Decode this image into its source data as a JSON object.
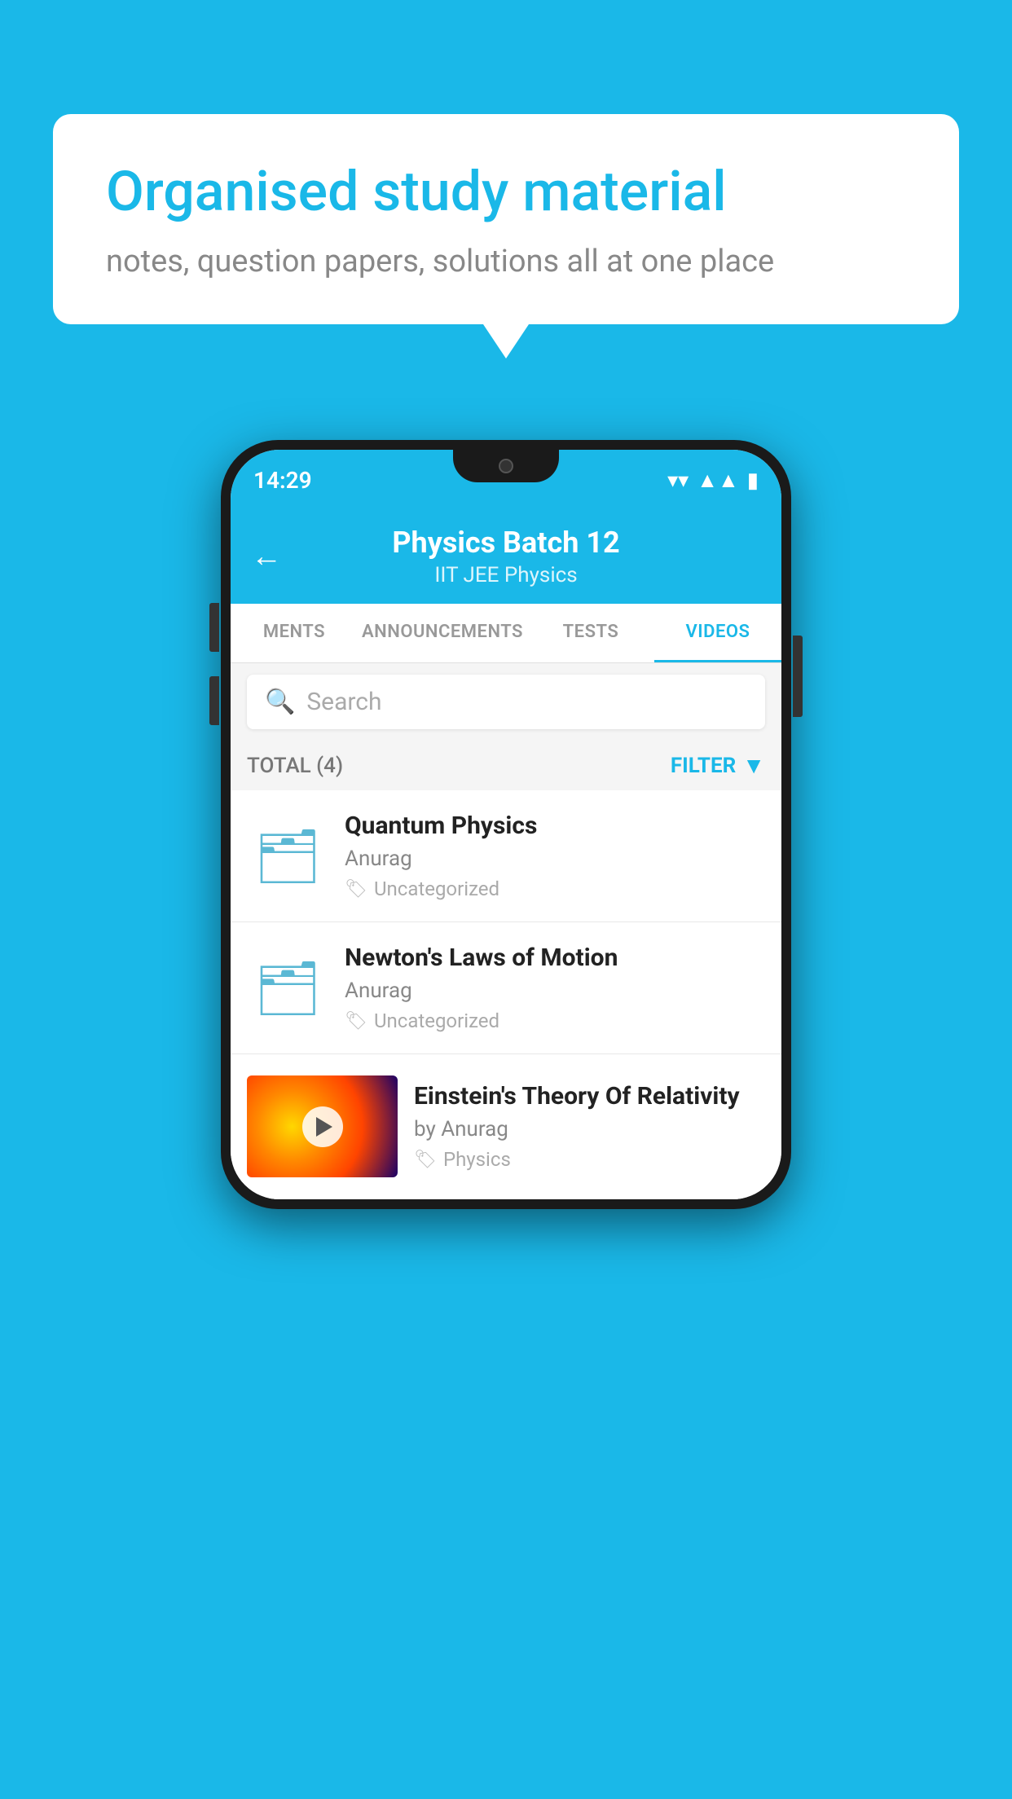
{
  "background_color": "#1ab8e8",
  "speech_bubble": {
    "title": "Organised study material",
    "subtitle": "notes, question papers, solutions all at one place"
  },
  "phone": {
    "status_bar": {
      "time": "14:29"
    },
    "app_bar": {
      "title": "Physics Batch 12",
      "subtitle": "IIT JEE   Physics",
      "back_label": "←"
    },
    "tabs": [
      {
        "label": "MENTS",
        "active": false
      },
      {
        "label": "ANNOUNCEMENTS",
        "active": false
      },
      {
        "label": "TESTS",
        "active": false
      },
      {
        "label": "VIDEOS",
        "active": true
      }
    ],
    "search": {
      "placeholder": "Search"
    },
    "filter_bar": {
      "total_label": "TOTAL (4)",
      "filter_label": "FILTER"
    },
    "videos": [
      {
        "title": "Quantum Physics",
        "author": "Anurag",
        "tag": "Uncategorized",
        "type": "folder",
        "has_thumb": false
      },
      {
        "title": "Newton's Laws of Motion",
        "author": "Anurag",
        "tag": "Uncategorized",
        "type": "folder",
        "has_thumb": false
      },
      {
        "title": "Einstein's Theory Of Relativity",
        "author": "by Anurag",
        "tag": "Physics",
        "type": "video",
        "has_thumb": true
      }
    ]
  }
}
